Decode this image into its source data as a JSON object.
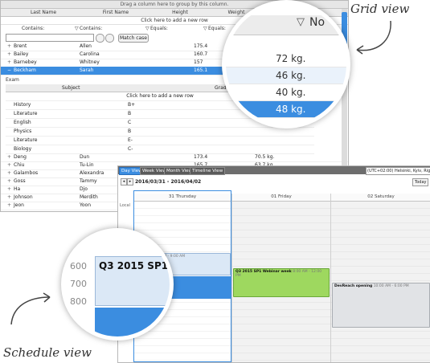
{
  "grid": {
    "group_hint": "Drag a column here to group by this column.",
    "columns": [
      "Last Name",
      "First Name",
      "Height",
      "Weight"
    ],
    "add_row": "Click here to add a new row",
    "filters": {
      "last_name": "Contains:",
      "first_name": "Contains:",
      "height": "Equals:",
      "weight": "Equals:"
    },
    "match_case": "Match case",
    "rows_top": [
      {
        "last": "Brent",
        "first": "Allen",
        "height": "175.4",
        "weight": ""
      },
      {
        "last": "Bailey",
        "first": "Carolina",
        "height": "160.7",
        "weight": ""
      },
      {
        "last": "Barnebey",
        "first": "Whitney",
        "height": "157",
        "weight": ""
      },
      {
        "last": "Beckham",
        "first": "Sarah",
        "height": "165.1",
        "weight": ""
      }
    ],
    "detail": {
      "label": "Exam",
      "columns": [
        "Subject",
        "Grade"
      ],
      "add_row": "Click here to add a new row",
      "rows": [
        {
          "subject": "History",
          "grade": "B+"
        },
        {
          "subject": "Literature",
          "grade": "B"
        },
        {
          "subject": "English",
          "grade": "C"
        },
        {
          "subject": "Physics",
          "grade": "B"
        },
        {
          "subject": "Literature",
          "grade": "E-"
        },
        {
          "subject": "Biology",
          "grade": "C-"
        }
      ]
    },
    "rows_bottom": [
      {
        "last": "Deng",
        "first": "Dun",
        "height": "173.4",
        "weight": "70.5 kg."
      },
      {
        "last": "Chiu",
        "first": "Tu-Lin",
        "height": "165.7",
        "weight": "63.7 kg."
      },
      {
        "last": "Galambos",
        "first": "Alexandra",
        "height": "",
        "weight": ""
      },
      {
        "last": "Goss",
        "first": "Tammy",
        "height": "",
        "weight": ""
      },
      {
        "last": "Ha",
        "first": "Djo",
        "height": "",
        "weight": ""
      },
      {
        "last": "Johnson",
        "first": "Merdith",
        "height": "",
        "weight": ""
      },
      {
        "last": "Jeon",
        "first": "Yoon",
        "height": "",
        "weight": ""
      }
    ]
  },
  "magnifier_grid": {
    "header": "No",
    "values": [
      "72 kg.",
      "46 kg.",
      "40 kg.",
      "48 kg."
    ]
  },
  "scheduler": {
    "tabs": [
      "Day View",
      "Week View",
      "Month View",
      "Timeline View"
    ],
    "timezone": "(UTC+02:00) Helsinki, Kyiv, Riga,",
    "date_range": "2016/03/31 - 2016/04/02",
    "today": "Today",
    "days": [
      "31 Thursday",
      "01 Friday",
      "02 Saturday"
    ],
    "local_label": "Local",
    "events": [
      {
        "title": "Q3 2015 SP1 Webinar week",
        "time": "8:00 AM - 12:00 PM",
        "color": "green"
      },
      {
        "title": "DevReach opening",
        "time": "10:00 AM - 6:00 PM",
        "color": "gray"
      },
      {
        "title": "...ouse",
        "time": "8:00 AM - 9:00 AM",
        "color": "blue"
      }
    ]
  },
  "magnifier_schedule": {
    "event_title": "Q3 2015 SP1 I",
    "hours": [
      "600",
      "700",
      "800"
    ]
  },
  "captions": {
    "grid": "Grid view",
    "schedule": "Schedule view"
  },
  "colors": {
    "accent": "#3b8de0",
    "green_event": "#9ed85f",
    "gray_event": "#e1e3e6"
  }
}
